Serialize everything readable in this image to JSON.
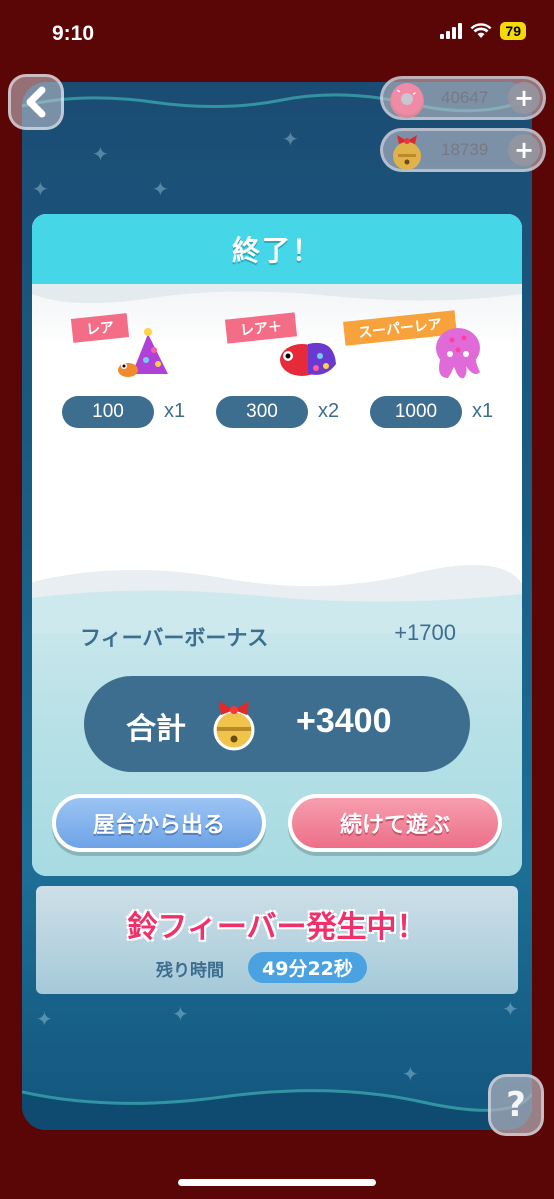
{
  "status_bar": {
    "time": "9:10",
    "battery": "79"
  },
  "currencies": [
    {
      "name": "donut",
      "amount": "40647",
      "plus": "+"
    },
    {
      "name": "bell",
      "amount": "18739",
      "plus": "+"
    }
  ],
  "modal": {
    "title": "終了！",
    "items": [
      {
        "rarity": "レア",
        "value": "100",
        "mult": "x1",
        "rarity_color": "#f46d86"
      },
      {
        "rarity": "レア＋",
        "value": "300",
        "mult": "x2",
        "rarity_color": "#f46d86"
      },
      {
        "rarity": "スーパーレア",
        "value": "1000",
        "mult": "x1",
        "rarity_color": "#f7a23a"
      }
    ],
    "bonus_label": "フィーバーボーナス",
    "bonus_value": "+1700",
    "total_label": "合計",
    "total_value": "+3400",
    "leave_button": "屋台から出る",
    "continue_button": "続けて遊ぶ"
  },
  "fever": {
    "title": "鈴フィーバー発生中！",
    "time_label": "残り時間",
    "time_value": "49分22秒"
  },
  "help_label": "?"
}
